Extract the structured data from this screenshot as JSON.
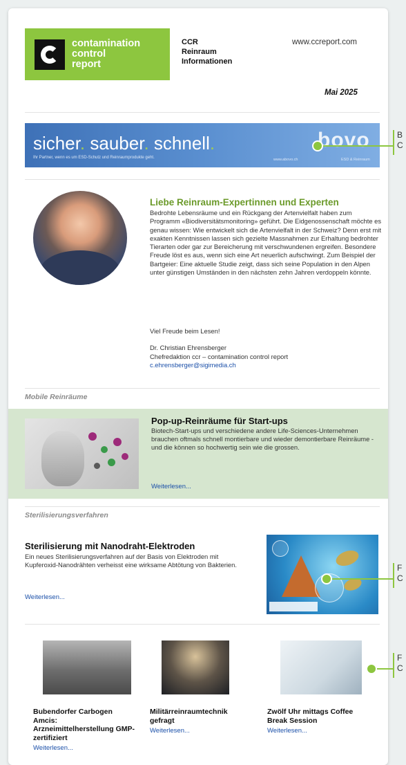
{
  "header": {
    "logo_lines": [
      "contamination",
      "control",
      "report"
    ],
    "ccr_lines": [
      "CCR",
      "Reinraum",
      "Informationen"
    ],
    "website": "www.ccreport.com",
    "date": "Mai 2025"
  },
  "banner": {
    "slogan_parts": [
      "sicher",
      ". ",
      "sauber",
      ". ",
      "schnell",
      "."
    ],
    "tagline": "Ihr Partner, wenn es um ESD-Schutz und Reinraumprodukte geht.",
    "url": "www.abovo.ch",
    "brand": "bovo",
    "brand_sub": "ESD & Reinraum"
  },
  "callouts": {
    "banner": [
      "B",
      "C"
    ],
    "steril": [
      "F",
      "C"
    ],
    "grid": [
      "F",
      "C"
    ]
  },
  "intro": {
    "title": "Liebe Reinraum-Expertinnen und Experten",
    "body": "Bedrohte Lebensräume und ein Rückgang der Artenvielfalt haben zum Programm «Biodiversitätsmonitoring» geführt. Die Eidgenossenschaft möchte es genau wissen: Wie entwickelt sich die Artenvielfalt in der Schweiz? Denn erst mit exakten Kenntnissen lassen sich gezielte Massnahmen zur Erhaltung bedrohter Tierarten oder gar zur Bereicherung mit verschwundenen ergreifen. Besondere Freude löst es aus, wenn sich eine Art neuerlich aufschwingt. Zum Beispiel der Bartgeier: Eine aktuelle Studie zeigt, dass sich seine Population in den Alpen unter günstigen Umständen in den nächsten zehn Jahren verdoppeln könnte.",
    "closing": "Viel Freude beim Lesen!",
    "author": "Dr. Christian Ehrensberger",
    "role": "Chefredaktion ccr – contamination control report",
    "email": "c.ehrensberger@sigimedia.ch"
  },
  "section_mobile": {
    "label": "Mobile Reinräume",
    "title": "Pop-up-Reinräume für Start-ups",
    "body": "Biotech-Start-ups und verschiedene andere Life-Sciences-Unternehmen brauchen oftmals schnell montierbare und wieder demontierbare Reinräume - und die können so hochwertig sein wie die grossen.",
    "link": "Weiterlesen..."
  },
  "section_steril": {
    "label": "Sterilisierungsverfahren",
    "title": "Sterilisierung mit Nanodraht-Elektroden",
    "body": "Ein neues Sterilisierungsverfahren auf der Basis von Elektroden mit Kupferoxid-Nanodrähten verheisst eine wirksame Abtötung von Bakterien.",
    "link": "Weiterlesen..."
  },
  "grid": [
    {
      "title": "Bubendorfer Carbogen Amcis: Arzneimittelherstellung GMP-zertifiziert",
      "link": "Weiterlesen..."
    },
    {
      "title": "Militärreinraumtechnik gefragt",
      "link": "Weiterlesen..."
    },
    {
      "title": "Zwölf Uhr mittags Coffee Break Session",
      "link": "Weiterlesen..."
    }
  ],
  "colors": {
    "brand_green": "#8dc63f",
    "link_blue": "#1a4fa8",
    "feature_bg": "#d6e6cf",
    "banner_blue": "#3e71b7"
  }
}
